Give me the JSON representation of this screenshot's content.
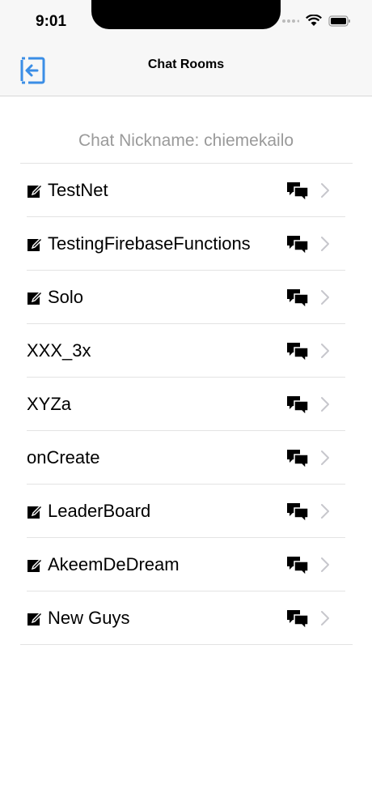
{
  "status_bar": {
    "time": "9:01"
  },
  "nav": {
    "title": "Chat Rooms",
    "back_icon": "exit-arrow-icon"
  },
  "nickname_text": "Chat Nickname: chiemekailo",
  "colors": {
    "accent": "#3b8ee6",
    "nickname": "#9a9a9a",
    "chevron": "#c7c7cc"
  },
  "rooms": [
    {
      "name": "TestNet",
      "editable": true
    },
    {
      "name": "TestingFirebaseFunctions",
      "editable": true
    },
    {
      "name": "Solo",
      "editable": true
    },
    {
      "name": "XXX_3x",
      "editable": false
    },
    {
      "name": "XYZa",
      "editable": false
    },
    {
      "name": "onCreate",
      "editable": false
    },
    {
      "name": "LeaderBoard",
      "editable": true
    },
    {
      "name": "AkeemDeDream",
      "editable": true
    },
    {
      "name": "New Guys",
      "editable": true
    }
  ]
}
